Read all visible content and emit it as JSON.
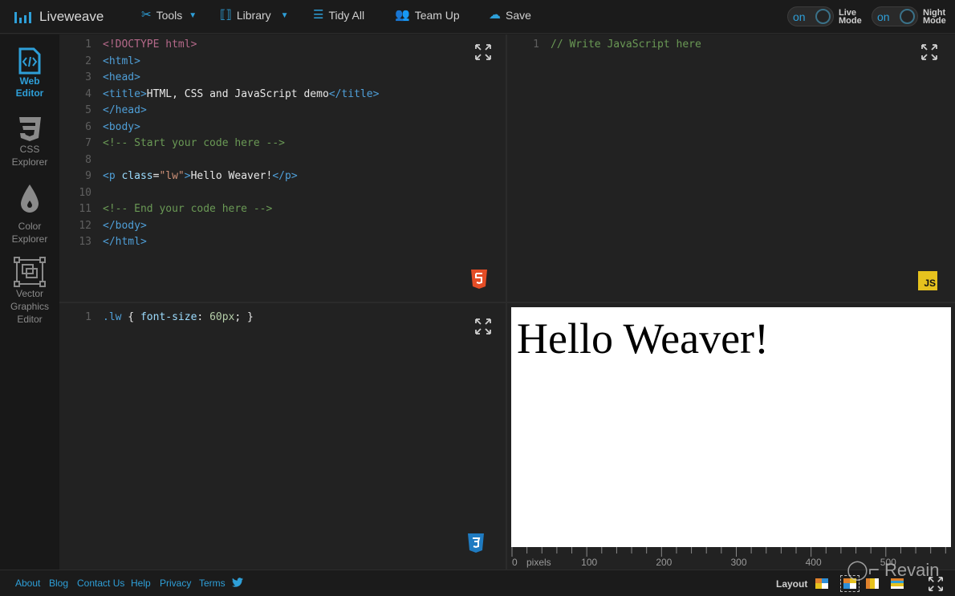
{
  "app": {
    "name": "Liveweave",
    "brand_color": "#2e9fd8"
  },
  "toolbar": {
    "tools_label": "Tools",
    "library_label": "Library",
    "tidy_label": "Tidy All",
    "teamup_label": "Team Up",
    "save_label": "Save",
    "live_mode": {
      "state": "on",
      "label_line1": "Live",
      "label_line2": "Mode"
    },
    "night_mode": {
      "state": "on",
      "label_line1": "Night",
      "label_line2": "Mode"
    }
  },
  "sidebar": {
    "items": [
      {
        "icon": "web-editor-icon",
        "line1": "Web",
        "line2": "Editor",
        "active": true
      },
      {
        "icon": "css3-icon",
        "line1": "CSS",
        "line2": "Explorer",
        "active": false
      },
      {
        "icon": "color-drop-icon",
        "line1": "Color",
        "line2": "Explorer",
        "active": false
      },
      {
        "icon": "vector-graphics-icon",
        "line1": "Vector",
        "line2": "Graphics",
        "line3": "Editor",
        "active": false
      }
    ]
  },
  "html_editor": {
    "lines": [
      {
        "n": "1",
        "parts": [
          [
            "doctype",
            "<!DOCTYPE html>"
          ]
        ]
      },
      {
        "n": "2",
        "parts": [
          [
            "tag",
            "<html>"
          ]
        ]
      },
      {
        "n": "3",
        "parts": [
          [
            "tag",
            "<head>"
          ]
        ]
      },
      {
        "n": "4",
        "parts": [
          [
            "tag",
            "<title>"
          ],
          [
            "text",
            "HTML, CSS and JavaScript demo"
          ],
          [
            "tag",
            "</title>"
          ]
        ]
      },
      {
        "n": "5",
        "parts": [
          [
            "tag",
            "</head>"
          ]
        ]
      },
      {
        "n": "6",
        "parts": [
          [
            "tag",
            "<body>"
          ]
        ]
      },
      {
        "n": "7",
        "parts": [
          [
            "comment",
            "<!-- Start your code here -->"
          ]
        ]
      },
      {
        "n": "8",
        "parts": []
      },
      {
        "n": "9",
        "parts": [
          [
            "tag",
            "<p "
          ],
          [
            "attr",
            "class"
          ],
          [
            "text",
            "="
          ],
          [
            "str",
            "\"lw\""
          ],
          [
            "tag",
            ">"
          ],
          [
            "text",
            "Hello Weaver!"
          ],
          [
            "tag",
            "</p>"
          ]
        ]
      },
      {
        "n": "10",
        "parts": []
      },
      {
        "n": "11",
        "parts": [
          [
            "comment",
            "<!-- End your code here -->"
          ]
        ]
      },
      {
        "n": "12",
        "parts": [
          [
            "tag",
            "</body>"
          ]
        ]
      },
      {
        "n": "13",
        "parts": [
          [
            "tag",
            "</html>"
          ]
        ]
      }
    ],
    "badge": "HTML5"
  },
  "js_editor": {
    "lines": [
      {
        "n": "1",
        "parts": [
          [
            "comment",
            "// Write JavaScript here"
          ]
        ]
      }
    ],
    "badge": "JS"
  },
  "css_editor": {
    "lines": [
      {
        "n": "1",
        "parts": [
          [
            "sel",
            ".lw"
          ],
          [
            "text",
            " { "
          ],
          [
            "prop",
            "font-size"
          ],
          [
            "text",
            ": "
          ],
          [
            "num",
            "60px"
          ],
          [
            "text",
            "; }"
          ]
        ]
      }
    ],
    "badge": "CSS3"
  },
  "preview": {
    "text": "Hello Weaver!",
    "ruler": {
      "unit_label": "pixels",
      "ticks": [
        "0",
        "100",
        "200",
        "300",
        "400",
        "500"
      ]
    }
  },
  "footer": {
    "links": [
      "About",
      "Blog",
      "Contact Us",
      "Help",
      "Privacy",
      "Terms"
    ],
    "twitter_icon": "twitter-icon",
    "layout_label": "Layout",
    "layout_selected": 2
  },
  "watermark": "Revain"
}
